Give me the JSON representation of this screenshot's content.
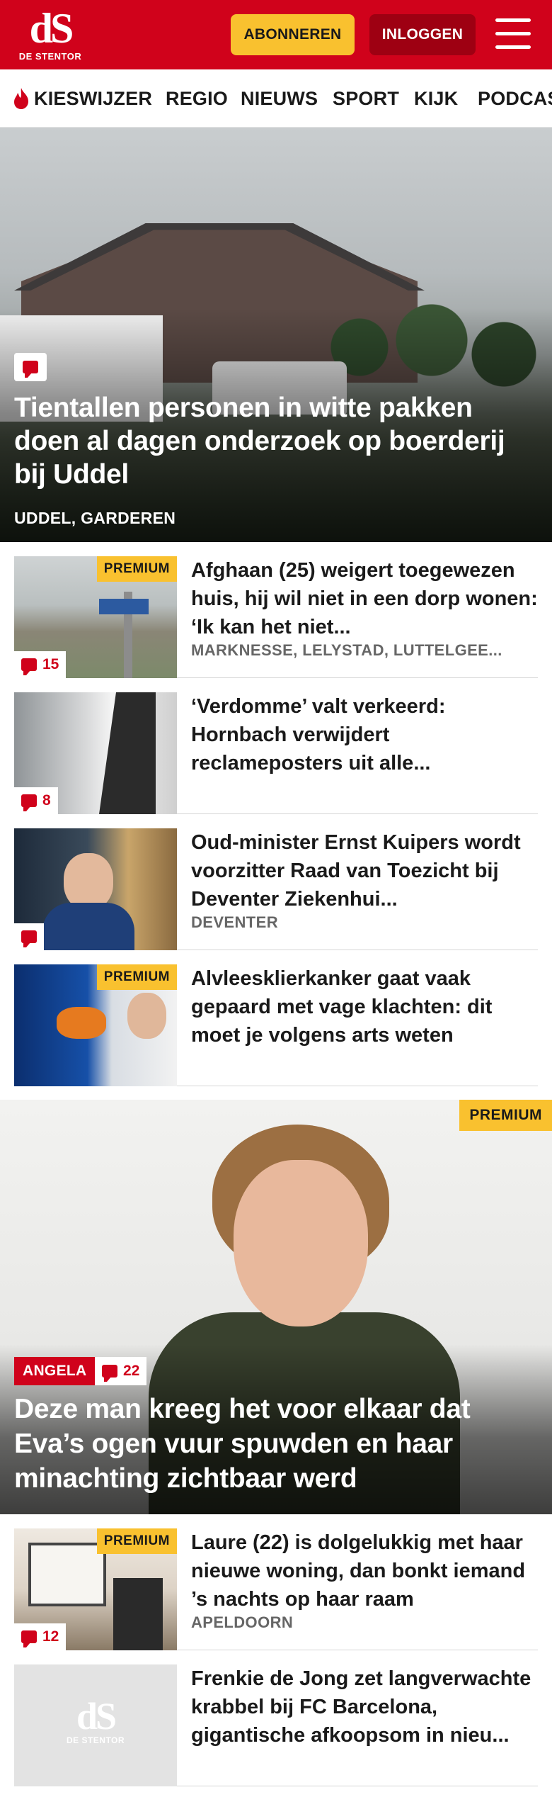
{
  "brand": {
    "logo_mark": "dS",
    "logo_sub": "DE STENTOR",
    "accent": "#d0021b",
    "premium_color": "#f9c12f"
  },
  "header": {
    "subscribe_label": "ABONNEREN",
    "login_label": "INLOGGEN",
    "menu_icon": "hamburger-icon"
  },
  "nav": {
    "items": [
      {
        "label": "KIESWIJZER",
        "icon": "flame-icon"
      },
      {
        "label": "REGIO"
      },
      {
        "label": "NIEUWS"
      },
      {
        "label": "SPORT"
      },
      {
        "label": "KIJK"
      },
      {
        "label": "PODCAS"
      }
    ]
  },
  "hero": {
    "title": "Tientallen personen in witte pakken doen al dagen onderzoek op boerderij bij Uddel",
    "location": "UDDEL, GARDEREN",
    "comment_icon": "comment-icon"
  },
  "articles": [
    {
      "title": "Afghaan (25) weigert toegewezen huis, hij wil niet in een dorp wonen: ‘Ik kan het niet...",
      "location": "MARKNESSE, LELYSTAD, LUTTELGEE...",
      "premium": "PREMIUM",
      "comments": "15"
    },
    {
      "title": "‘Verdomme’ valt verkeerd: Hornbach verwijdert reclameposters uit alle...",
      "location": "",
      "premium": "",
      "comments": "8"
    },
    {
      "title": "Oud-minister Ernst Kuipers wordt voorzitter Raad van Toezicht bij Deventer Ziekenhui...",
      "location": "DEVENTER",
      "premium": "",
      "comments": ""
    },
    {
      "title": "Alvleesklierkanker gaat vaak gepaard met vage klachten: dit moet je volgens arts weten",
      "location": "",
      "premium": "PREMIUM",
      "comments": ""
    }
  ],
  "feature": {
    "premium": "PREMIUM",
    "tag": "ANGELA",
    "comments": "22",
    "title": "Deze man kreeg het voor elkaar dat Eva’s ogen vuur spuwden en haar minachting zichtbaar werd"
  },
  "articles_2": [
    {
      "title": "Laure (22) is dolgelukkig met haar nieuwe woning, dan bonkt iemand ’s nachts op haar raam",
      "location": "APELDOORN",
      "premium": "PREMIUM",
      "comments": "12"
    },
    {
      "title": "Frenkie de Jong zet langver­wachte krabbel bij FC Barcelona, gigantische afkoopsom in nieu...",
      "location": "",
      "premium": "",
      "comments": "",
      "placeholder_logo": "dS",
      "placeholder_sub": "DE STENTOR"
    }
  ]
}
